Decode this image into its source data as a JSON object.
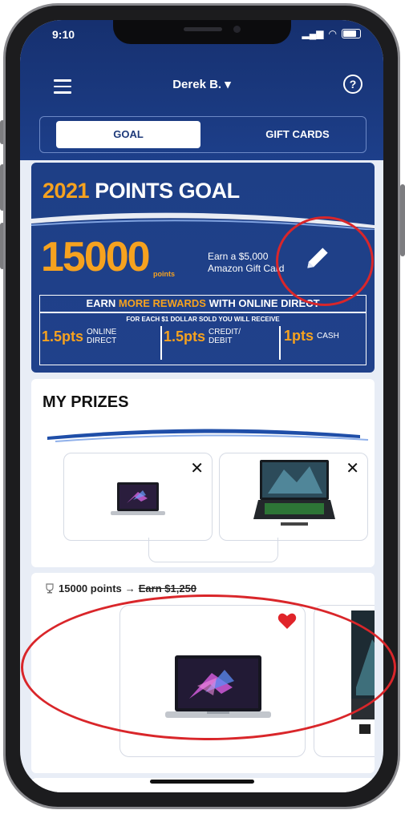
{
  "status_bar": {
    "time": "9:10"
  },
  "header": {
    "user_name": "Derek B. ▾"
  },
  "tabs": [
    {
      "label": "GOAL"
    },
    {
      "label": "GIFT CARDS"
    }
  ],
  "goal": {
    "title_year": "2021",
    "title_text": " POINTS GOAL",
    "points": "15000",
    "points_unit": "points",
    "earn_line1": "Earn a $5,000",
    "earn_line2": "Amazon Gift Card",
    "rewards_head_1": "EARN ",
    "rewards_head_more": "MORE REWARDS",
    "rewards_head_2": " WITH ONLINE DIRECT",
    "rewards_sub": "FOR EACH $1 DOLLAR SOLD YOU WILL RECEIVE",
    "rates": [
      {
        "pts": "1.5pts",
        "label_1": "ONLINE",
        "label_2": "DIRECT"
      },
      {
        "pts": "1.5pts",
        "label_1": "CREDIT/",
        "label_2": "DEBIT"
      },
      {
        "pts": "1pts",
        "label_1": "CASH",
        "label_2": ""
      }
    ]
  },
  "prizes": {
    "title": "MY PRIZES",
    "close_symbol": "✕"
  },
  "feed": {
    "points_text": "15000 points",
    "arrow": "→",
    "earn_text": "Earn $1,250"
  },
  "colors": {
    "navy": "#1d3f8a",
    "orange": "#f6a21f",
    "annotation_red": "#d9262a"
  }
}
